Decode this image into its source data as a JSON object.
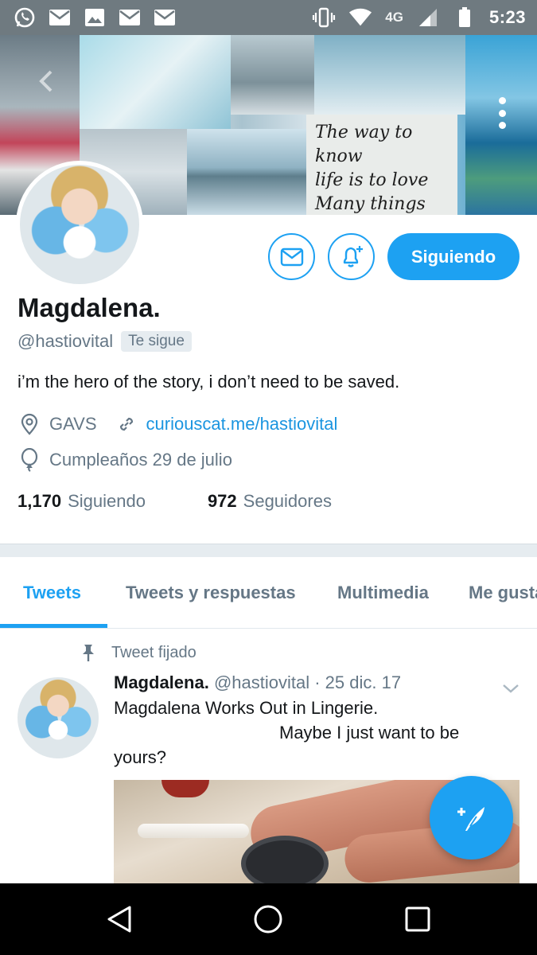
{
  "status_bar": {
    "time": "5:23",
    "network": "4G",
    "left_icons": [
      "whatsapp-icon",
      "mail-icon",
      "image-icon",
      "mail-icon",
      "mail-icon"
    ],
    "right_icons": [
      "vibrate-icon",
      "wifi-icon",
      "signal-icon",
      "battery-icon"
    ]
  },
  "banner": {
    "quote_lines": [
      "The way to know",
      "life is to love",
      "Many things"
    ]
  },
  "actions": {
    "follow_label": "Siguiendo"
  },
  "profile": {
    "name": "Magdalena.",
    "handle": "@hastiovital",
    "follows_you": "Te sigue",
    "bio": "i’m the hero of the story, i don’t need to be saved.",
    "location": "GAVS",
    "website": "curiouscat.me/hastiovital",
    "birthday": "Cumpleaños 29 de julio",
    "following_count": "1,170",
    "following_label": "Siguiendo",
    "followers_count": "972",
    "followers_label": "Seguidores"
  },
  "tabs": [
    {
      "label": "Tweets",
      "active": true
    },
    {
      "label": "Tweets y respuestas",
      "active": false
    },
    {
      "label": "Multimedia",
      "active": false
    },
    {
      "label": "Me gusta",
      "active": false
    }
  ],
  "tweet": {
    "pinned_label": "Tweet fijado",
    "author": "Magdalena.",
    "meta": "@hastiovital · 25 dic. 17",
    "text_line1": "Magdalena Works Out in Lingerie.",
    "text_line2": "Maybe I just want to be",
    "text_line3": "yours?"
  },
  "colors": {
    "accent": "#1da1f2",
    "secondary_text": "#657786",
    "link": "#1b95e0",
    "status_bar": "#6f7a80"
  }
}
